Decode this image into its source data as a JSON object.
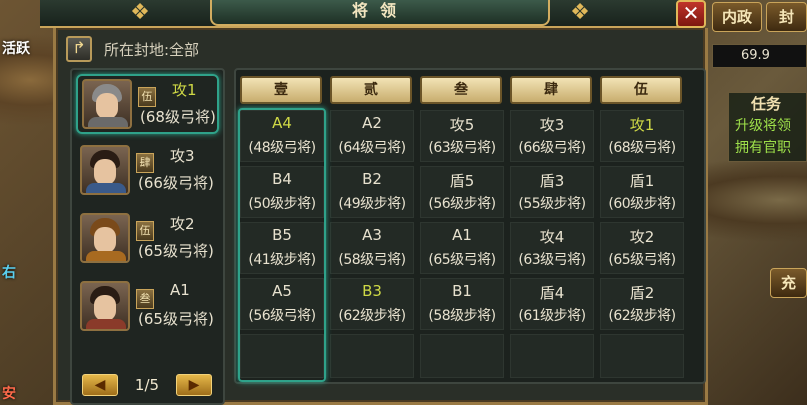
{
  "window": {
    "title": "将领",
    "close": "✕"
  },
  "fief_label": "所在封地:全部",
  "side_left": {
    "activity": "活跃",
    "tag1": "右",
    "tag2": "安"
  },
  "side_right": {
    "btn1": "内政",
    "btn2": "封",
    "resource": "69.9",
    "task_title": "任务",
    "task_line1": "升级将领",
    "task_line2": "拥有官职",
    "charge": "充"
  },
  "generals": [
    {
      "name": "攻1",
      "rank": "伍",
      "level": "(68级弓将)",
      "selected": true
    },
    {
      "name": "攻3",
      "rank": "肆",
      "level": "(66级弓将)",
      "selected": false
    },
    {
      "name": "攻2",
      "rank": "伍",
      "level": "(65级弓将)",
      "selected": false
    },
    {
      "name": "A1",
      "rank": "叁",
      "level": "(65级弓将)",
      "selected": false
    }
  ],
  "pager": {
    "page": "1/5",
    "prev": "◀",
    "next": "▶"
  },
  "columns": [
    "壹",
    "贰",
    "叁",
    "肆",
    "伍"
  ],
  "grid": [
    [
      {
        "n": "A4",
        "l": "(48级弓将)",
        "hl": true
      },
      {
        "n": "A2",
        "l": "(64级弓将)"
      },
      {
        "n": "攻5",
        "l": "(63级弓将)"
      },
      {
        "n": "攻3",
        "l": "(66级弓将)"
      },
      {
        "n": "攻1",
        "l": "(68级弓将)",
        "hl": true
      }
    ],
    [
      {
        "n": "B4",
        "l": "(50级步将)"
      },
      {
        "n": "B2",
        "l": "(49级步将)"
      },
      {
        "n": "盾5",
        "l": "(56级步将)"
      },
      {
        "n": "盾3",
        "l": "(55级步将)"
      },
      {
        "n": "盾1",
        "l": "(60级步将)"
      }
    ],
    [
      {
        "n": "B5",
        "l": "(41级步将)"
      },
      {
        "n": "A3",
        "l": "(58级弓将)"
      },
      {
        "n": "A1",
        "l": "(65级弓将)"
      },
      {
        "n": "攻4",
        "l": "(63级弓将)"
      },
      {
        "n": "攻2",
        "l": "(65级弓将)"
      }
    ],
    [
      {
        "n": "A5",
        "l": "(56级弓将)"
      },
      {
        "n": "B3",
        "l": "(62级步将)",
        "hl": true
      },
      {
        "n": "B1",
        "l": "(58级步将)"
      },
      {
        "n": "盾4",
        "l": "(61级步将)"
      },
      {
        "n": "盾2",
        "l": "(62级步将)"
      }
    ]
  ]
}
